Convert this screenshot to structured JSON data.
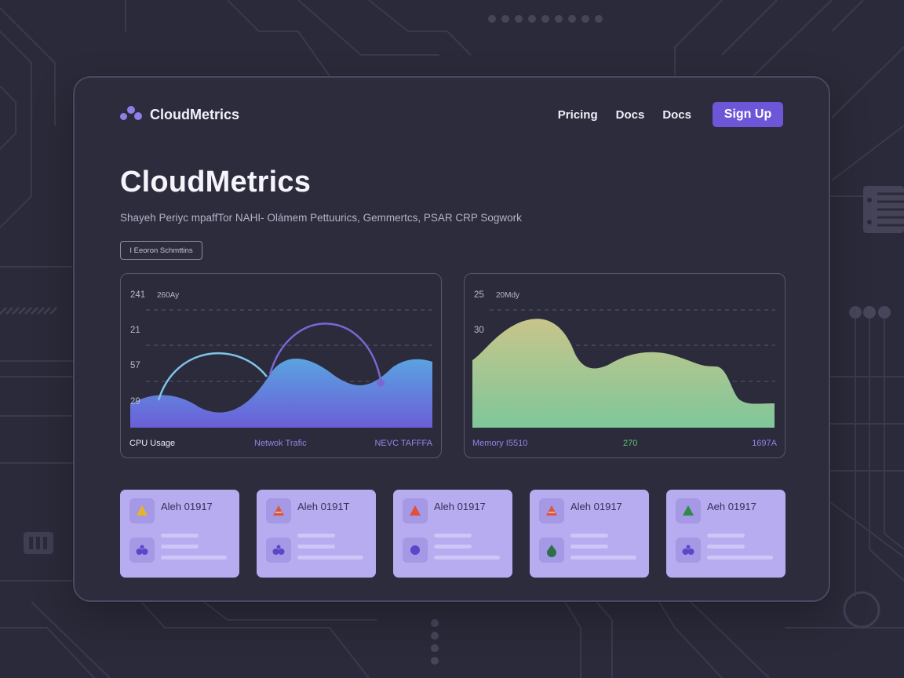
{
  "brand": {
    "name": "CloudMetrics"
  },
  "nav": {
    "items": [
      "Pricing",
      "Docs",
      "Docs"
    ],
    "cta": "Sign Up"
  },
  "hero": {
    "title": "CloudMetrics",
    "subtitle": "Shayeh Periyc mpaffTor NAHI- Olámem Pettuurics,  Gemmertcs,  PSAR CRP Sogwork",
    "button": "I Eeoron Schmttins"
  },
  "charts": [
    {
      "ticks": [
        "241",
        "21",
        "57",
        "29"
      ],
      "header_note": "260Ay",
      "labels": {
        "left": "CPU Usage",
        "middle": "Netwok Trafic",
        "right": "NEVC TAFFFA"
      }
    },
    {
      "ticks": [
        "25",
        "30"
      ],
      "header_note": "20Mdy",
      "labels": {
        "left": "Memory I5510",
        "middle": "270",
        "right": "1697A"
      }
    }
  ],
  "colors": {
    "accent": "#6e56d9",
    "cpu_gradient": [
      "#5aa3e0",
      "#6b5ed8"
    ],
    "memory_gradient": [
      "#c8c58a",
      "#7fc79a"
    ],
    "arc_light": "#7fc4e8",
    "arc_purple": "#7a67d4"
  },
  "alerts": [
    {
      "title": "Aleh 01917",
      "icon_top": "warning-triangle-icon",
      "icon_bottom": "group-icon",
      "icon_color": "#e6b42a"
    },
    {
      "title": "Aleh 0191T",
      "icon_top": "warning-triangle-icon",
      "icon_bottom": "group-icon",
      "icon_color": "#d9573e"
    },
    {
      "title": "Aleh 01917",
      "icon_top": "warning-triangle-icon",
      "icon_bottom": "dot-icon",
      "icon_color": "#e0503e"
    },
    {
      "title": "Aleh 01917",
      "icon_top": "warning-triangle-icon",
      "icon_bottom": "drop-icon",
      "icon_color": "#d9573e"
    },
    {
      "title": "Aeh 01917",
      "icon_top": "warning-triangle-icon",
      "icon_bottom": "group-icon",
      "icon_color": "#2e8a4a"
    }
  ]
}
